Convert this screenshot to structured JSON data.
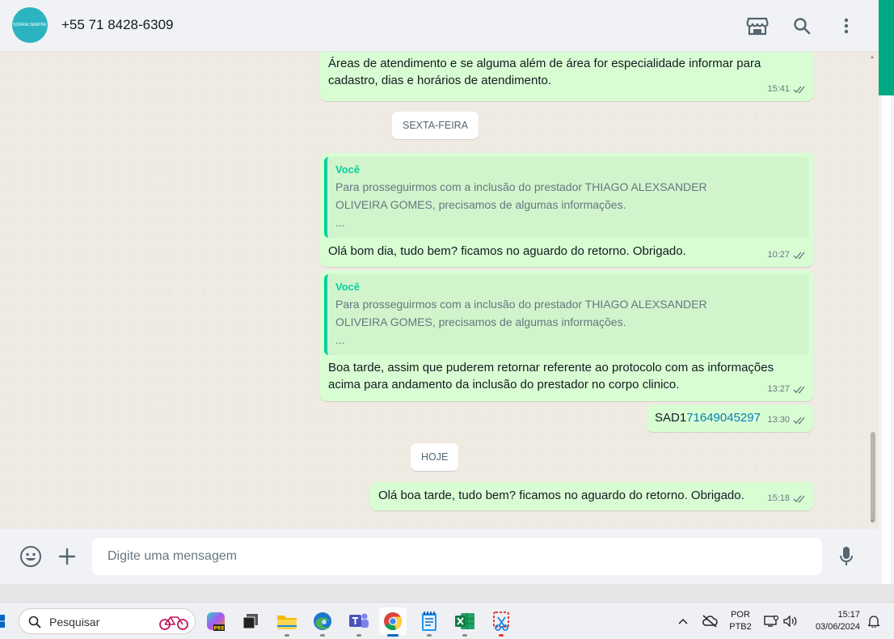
{
  "header": {
    "avatar_text": "SORRIA SEMPRE",
    "contact": "+55 71 8428-6309",
    "icons": [
      "shop-icon",
      "search-icon",
      "menu-icon"
    ]
  },
  "messages": [
    {
      "text": "Áreas de atendimento e se alguma além de área for especialidade informar para cadastro, dias e horários de atendimento.",
      "time": "15:41"
    },
    {
      "quote_author": "Você",
      "quote_line1": "Para prosseguirmos com a inclusão do prestador THIAGO ALEXSANDER",
      "quote_line2": "OLIVEIRA GOMES, precisamos de algumas informações.",
      "quote_line3": "...",
      "text": "Olá bom dia, tudo bem? ficamos no aguardo do retorno. Obrigado.",
      "time": "10:27"
    },
    {
      "quote_author": "Você",
      "quote_line1": "Para prosseguirmos com a inclusão do prestador THIAGO ALEXSANDER",
      "quote_line2": "OLIVEIRA GOMES, precisamos de algumas informações.",
      "quote_line3": "...",
      "text": "Boa tarde, assim que puderem retornar referente ao protocolo com as informações acima para andamento da inclusão do prestador no corpo clinico.",
      "time": "13:27"
    },
    {
      "text_prefix": "SAD1",
      "text_link": "71649045297",
      "time": "13:30"
    },
    {
      "text": "Olá boa tarde, tudo bem? ficamos no aguardo do retorno. Obrigado.",
      "time": "15:18"
    }
  ],
  "date_chips": [
    "SEXTA-FEIRA",
    "HOJE"
  ],
  "composer": {
    "placeholder": "Digite uma mensagem"
  },
  "taskbar": {
    "search_label": "Pesquisar",
    "lang_line1": "POR",
    "lang_line2": "PTB2",
    "time": "15:17",
    "date": "03/06/2024"
  },
  "colors": {
    "bubble": "#d9fdd3",
    "accent": "#00a884",
    "background": "#efeae2"
  }
}
